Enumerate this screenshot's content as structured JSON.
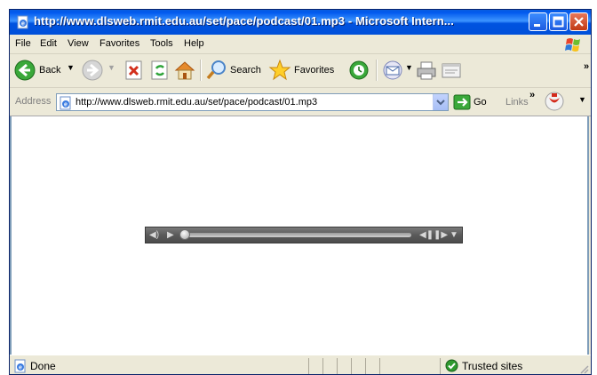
{
  "window": {
    "title": "http://www.dlsweb.rmit.edu.au/set/pace/podcast/01.mp3 - Microsoft Intern..."
  },
  "menubar": {
    "items": [
      {
        "label": "File",
        "accel": "F"
      },
      {
        "label": "Edit",
        "accel": "E"
      },
      {
        "label": "View",
        "accel": "V"
      },
      {
        "label": "Favorites",
        "accel": "a"
      },
      {
        "label": "Tools",
        "accel": "T"
      },
      {
        "label": "Help",
        "accel": "H"
      }
    ]
  },
  "toolbar": {
    "back_label": "Back",
    "search_label": "Search",
    "favorites_label": "Favorites",
    "overflow": "»"
  },
  "addressbar": {
    "label": "Address",
    "url": "http://www.dlsweb.rmit.edu.au/set/pace/podcast/01.mp3",
    "go_label": "Go",
    "links_label": "Links",
    "overflow": "»"
  },
  "player": {
    "progress": 0
  },
  "statusbar": {
    "status": "Done",
    "zone": "Trusted sites"
  },
  "colors": {
    "title_blue": "#0058ee",
    "chrome": "#ece9d8",
    "player_gray": "#5a5a5a"
  },
  "icons": [
    "ie-page-icon",
    "back-arrow-icon",
    "forward-arrow-icon",
    "stop-icon",
    "refresh-icon",
    "home-icon",
    "search-magnifier-icon",
    "favorites-star-icon",
    "history-icon",
    "mail-icon",
    "print-icon",
    "edit-icon",
    "go-arrow-icon",
    "pdf-icon",
    "windows-logo-icon",
    "trusted-check-icon",
    "resize-grip-icon"
  ]
}
